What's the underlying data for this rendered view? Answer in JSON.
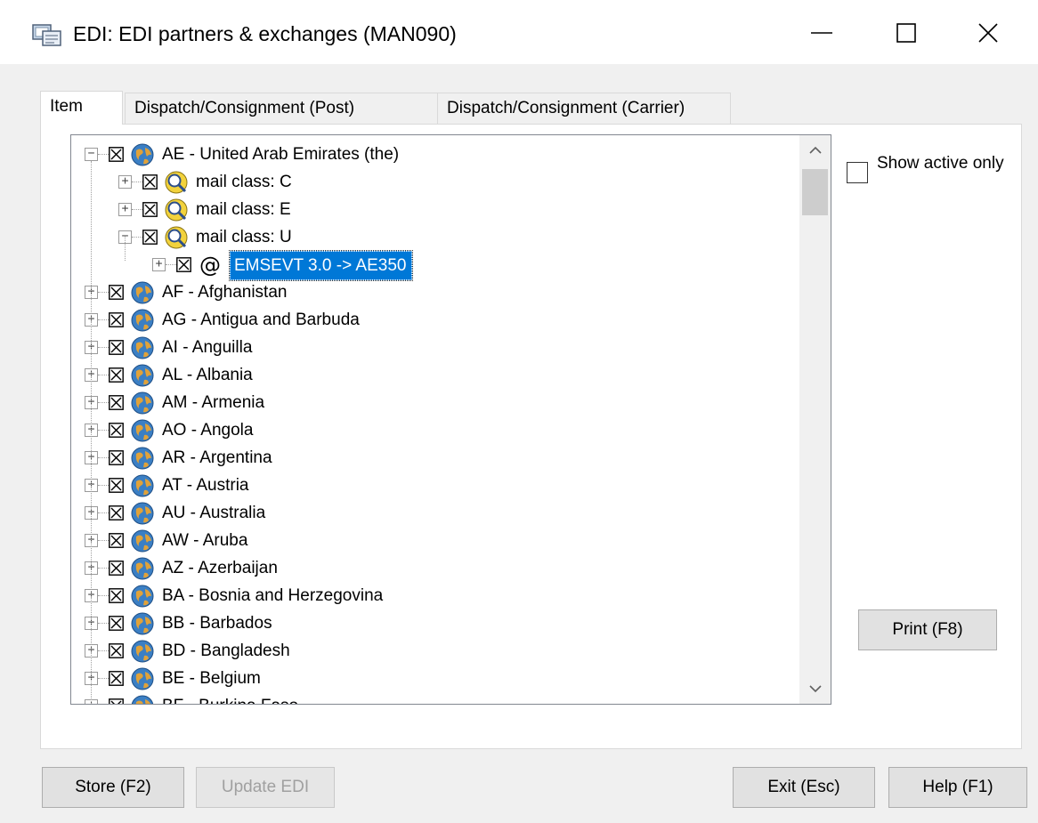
{
  "window": {
    "title": "EDI: EDI partners & exchanges (MAN090)",
    "app_icon": "edi-window-icon",
    "controls": [
      "minimize-icon",
      "maximize-icon",
      "close-icon"
    ]
  },
  "tabs": [
    {
      "label": "Item",
      "active": true
    },
    {
      "label": "Dispatch/Consignment (Post)",
      "active": false
    },
    {
      "label": "Dispatch/Consignment (Carrier)",
      "active": false
    }
  ],
  "tree": {
    "rows": [
      {
        "level": 0,
        "expander": "−",
        "icon": "globe-icon",
        "label": "AE - United Arab Emirates (the)",
        "checked": true
      },
      {
        "level": 1,
        "expander": "+",
        "icon": "mail-class-icon",
        "label": "mail class: C",
        "checked": true
      },
      {
        "level": 1,
        "expander": "+",
        "icon": "mail-class-icon",
        "label": "mail class: E",
        "checked": true
      },
      {
        "level": 1,
        "expander": "−",
        "icon": "mail-class-icon",
        "label": "mail class: U",
        "checked": true
      },
      {
        "level": 2,
        "expander": "+",
        "icon": "at-sign-icon",
        "label": "EMSEVT 3.0 -> AE350",
        "checked": true,
        "selected": true
      },
      {
        "level": 0,
        "expander": "+",
        "icon": "globe-icon",
        "label": "AF - Afghanistan",
        "checked": true
      },
      {
        "level": 0,
        "expander": "+",
        "icon": "globe-icon",
        "label": "AG - Antigua and Barbuda",
        "checked": true
      },
      {
        "level": 0,
        "expander": "+",
        "icon": "globe-icon",
        "label": "AI - Anguilla",
        "checked": true
      },
      {
        "level": 0,
        "expander": "+",
        "icon": "globe-icon",
        "label": "AL - Albania",
        "checked": true
      },
      {
        "level": 0,
        "expander": "+",
        "icon": "globe-icon",
        "label": "AM - Armenia",
        "checked": true
      },
      {
        "level": 0,
        "expander": "+",
        "icon": "globe-icon",
        "label": "AO - Angola",
        "checked": true
      },
      {
        "level": 0,
        "expander": "+",
        "icon": "globe-icon",
        "label": "AR - Argentina",
        "checked": true
      },
      {
        "level": 0,
        "expander": "+",
        "icon": "globe-icon",
        "label": "AT - Austria",
        "checked": true
      },
      {
        "level": 0,
        "expander": "+",
        "icon": "globe-icon",
        "label": "AU - Australia",
        "checked": true
      },
      {
        "level": 0,
        "expander": "+",
        "icon": "globe-icon",
        "label": "AW - Aruba",
        "checked": true
      },
      {
        "level": 0,
        "expander": "+",
        "icon": "globe-icon",
        "label": "AZ - Azerbaijan",
        "checked": true
      },
      {
        "level": 0,
        "expander": "+",
        "icon": "globe-icon",
        "label": "BA - Bosnia and Herzegovina",
        "checked": true
      },
      {
        "level": 0,
        "expander": "+",
        "icon": "globe-icon",
        "label": "BB - Barbados",
        "checked": true
      },
      {
        "level": 0,
        "expander": "+",
        "icon": "globe-icon",
        "label": "BD - Bangladesh",
        "checked": true
      },
      {
        "level": 0,
        "expander": "+",
        "icon": "globe-icon",
        "label": "BE - Belgium",
        "checked": true
      },
      {
        "level": 0,
        "expander": "+",
        "icon": "globe-icon",
        "label": "BF - Burkina Faso",
        "checked": true
      }
    ]
  },
  "options": {
    "show_active_only_label": "Show active only",
    "show_active_only_checked": false
  },
  "buttons": {
    "print": "Print (F8)",
    "store": "Store (F2)",
    "update_edi": "Update EDI",
    "exit": "Exit (Esc)",
    "help": "Help (F1)"
  },
  "colors": {
    "selection": "#0078d7",
    "window_bg": "#f0f0f0",
    "panel_bg": "#ffffff"
  }
}
